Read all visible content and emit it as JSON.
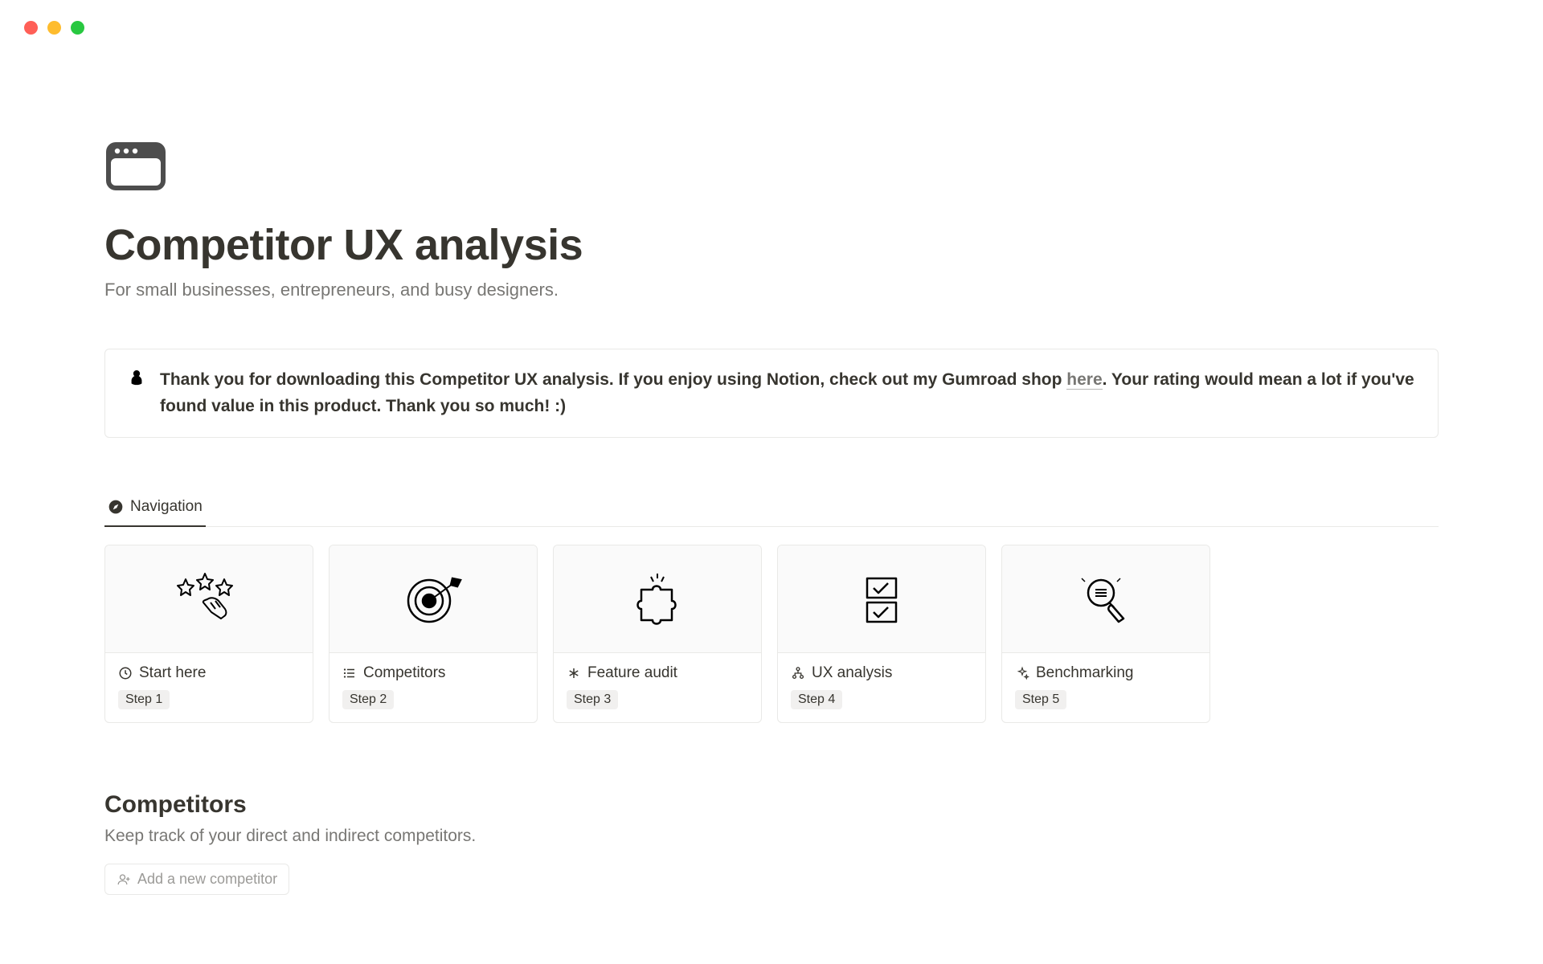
{
  "header": {
    "title": "Competitor UX analysis",
    "subtitle": "For small businesses, entrepreneurs, and busy designers."
  },
  "callout": {
    "text_before": "Thank you for downloading this Competitor UX analysis. If you enjoy using Notion, check out my Gumroad shop ",
    "link_text": "here",
    "text_after": ". Your rating would mean a lot if you've found value in this product. Thank you so much! :)"
  },
  "nav": {
    "tab_label": "Navigation",
    "cards": [
      {
        "title": "Start here",
        "step": "Step 1"
      },
      {
        "title": "Competitors",
        "step": "Step 2"
      },
      {
        "title": "Feature audit",
        "step": "Step 3"
      },
      {
        "title": "UX analysis",
        "step": "Step 4"
      },
      {
        "title": "Benchmarking",
        "step": "Step 5"
      }
    ]
  },
  "competitors": {
    "title": "Competitors",
    "subtitle": "Keep track of your direct and indirect competitors.",
    "add_label": "Add a new competitor"
  }
}
